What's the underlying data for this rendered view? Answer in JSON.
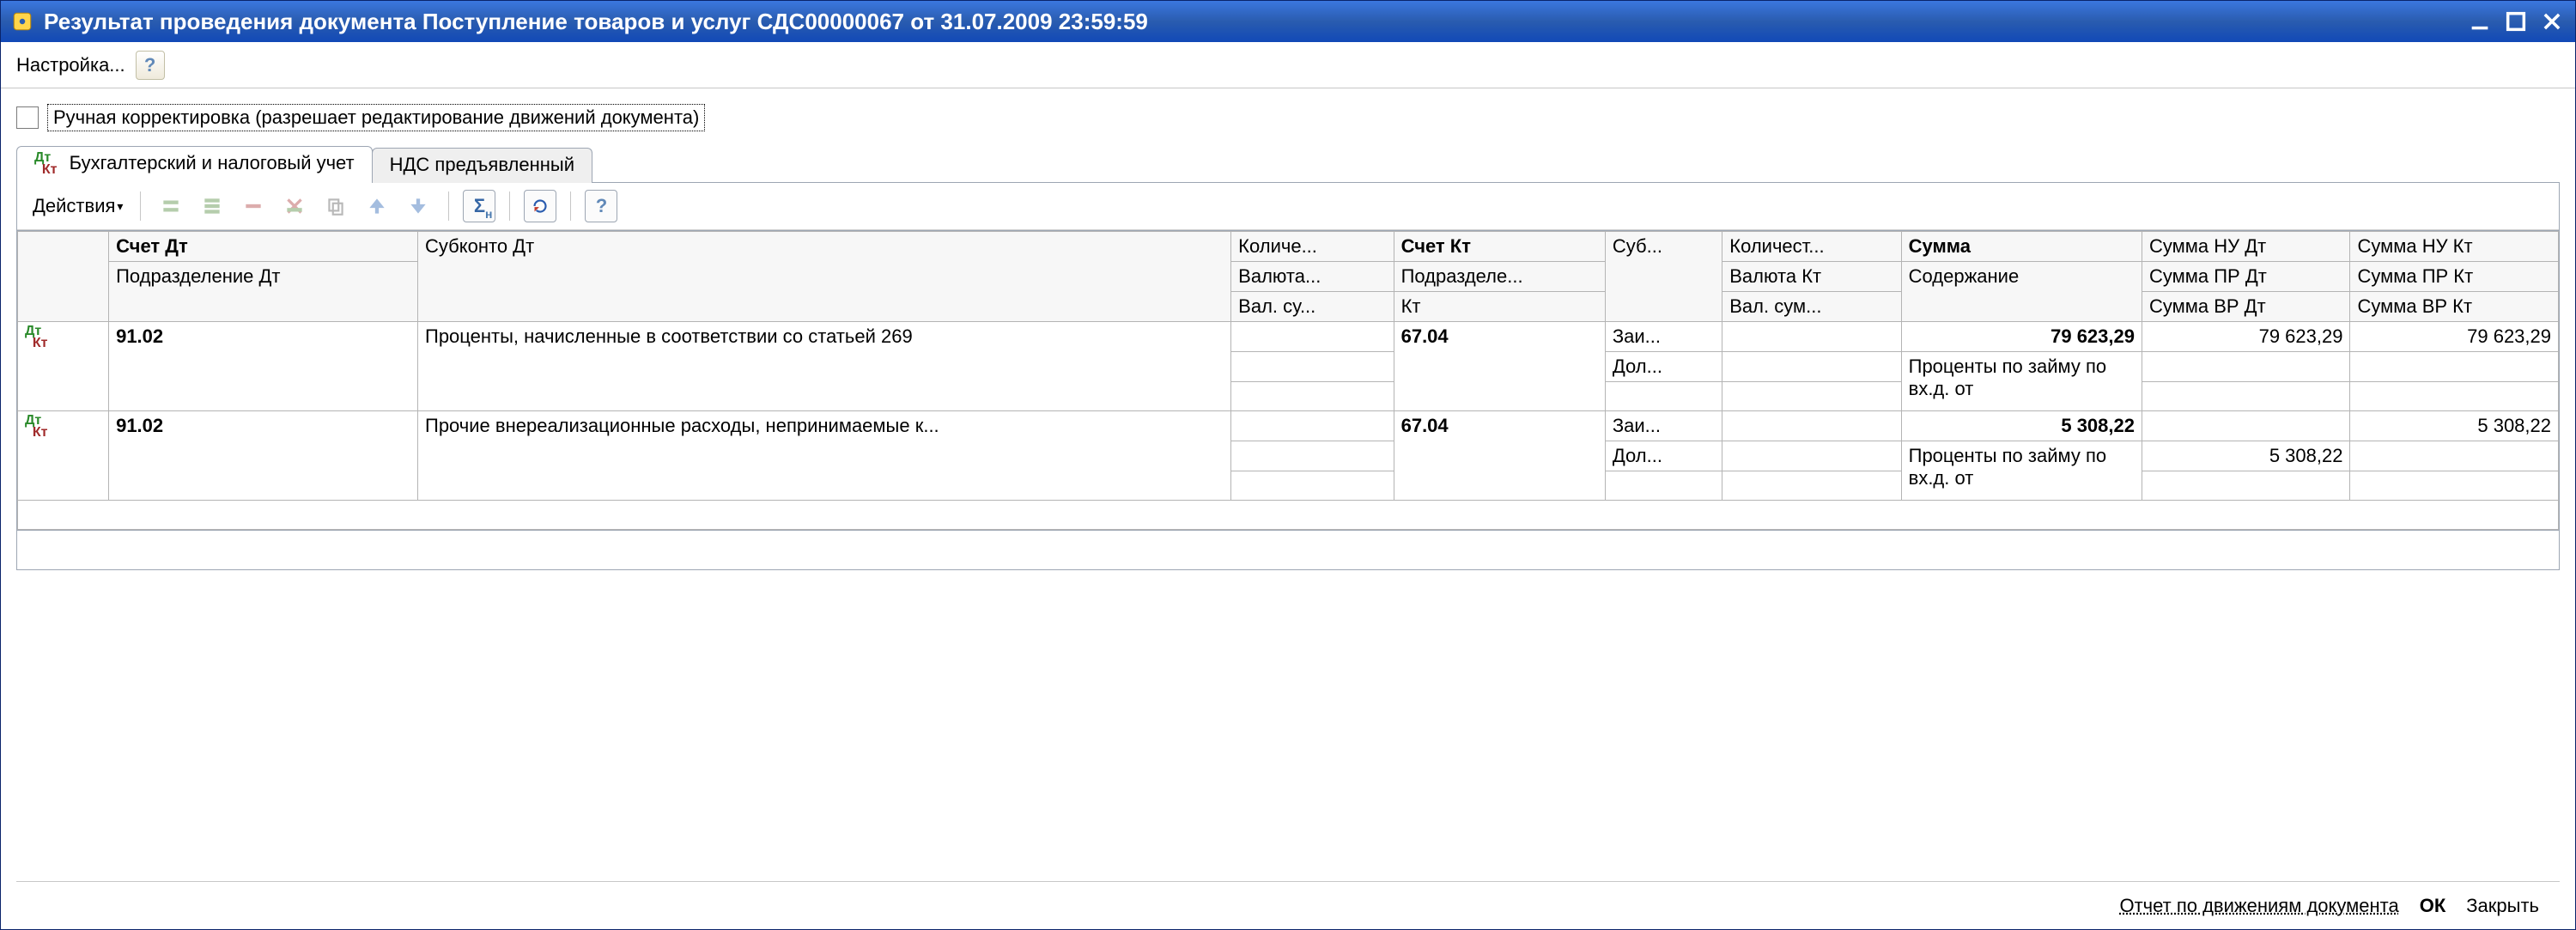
{
  "window": {
    "title": "Результат проведения документа Поступление товаров и услуг СДС00000067 от 31.07.2009 23:59:59",
    "minimize_tooltip": "Свернуть",
    "maximize_tooltip": "Развернуть",
    "close_tooltip": "Закрыть"
  },
  "actionbar": {
    "settings": "Настройка...",
    "help": "?"
  },
  "manual_edit": {
    "checked": false,
    "label": "Ручная корректировка (разрешает редактирование движений документа)"
  },
  "tabs": {
    "accounting": "Бухгалтерский и налоговый учет",
    "vat": "НДС предъявленный"
  },
  "toolbar": {
    "actions": "Действия",
    "help": "?",
    "sigma": "Σ"
  },
  "columns": {
    "r1": {
      "account_dt": "Счет Дт",
      "subkonto_dt": "Субконто Дт",
      "qty_dt": "Количе...",
      "account_kt": "Счет Кт",
      "subkonto_kt": "Суб...",
      "qty_kt": "Количест...",
      "sum": "Сумма",
      "sum_nu_dt": "Сумма НУ Дт",
      "sum_nu_kt": "Сумма НУ Кт"
    },
    "r2": {
      "division_dt": "Подразделение Дт",
      "currency_dt": "Валюта...",
      "division_kt": "Подразделе...",
      "currency_kt": "Валюта Кт",
      "content": "Содержание",
      "sum_pr_dt": "Сумма ПР Дт",
      "sum_pr_kt": "Сумма ПР Кт"
    },
    "r3": {
      "val_sum_dt": "Вал. су...",
      "kt": "Кт",
      "val_sum_kt": "Вал. сум...",
      "sum_vr_dt": "Сумма ВР Дт",
      "sum_vr_kt": "Сумма ВР Кт"
    }
  },
  "rows": [
    {
      "account_dt": "91.02",
      "subkonto_dt": "Проценты, начисленные в соответствии со статьей 269",
      "account_kt": "67.04",
      "subkonto_kt_1": "Заи...",
      "subkonto_kt_2": "Дол...",
      "sum": "79 623,29",
      "content": "Проценты по займу по вх.д. от",
      "sum_nu_dt": "79 623,29",
      "sum_nu_kt": "79 623,29",
      "sum_pr_dt": "",
      "sum_pr_kt": "",
      "sum_vr_dt": "",
      "sum_vr_kt": ""
    },
    {
      "account_dt": "91.02",
      "subkonto_dt": "Прочие внереализационные расходы, непринимаемые к...",
      "account_kt": "67.04",
      "subkonto_kt_1": "Заи...",
      "subkonto_kt_2": "Дол...",
      "sum": "5 308,22",
      "content": "Проценты по займу по вх.д. от",
      "sum_nu_dt": "",
      "sum_nu_kt": "5 308,22",
      "sum_pr_dt": "5 308,22",
      "sum_pr_kt": "",
      "sum_vr_dt": "",
      "sum_vr_kt": ""
    }
  ],
  "footer": {
    "report": "Отчет по движениям документа",
    "ok": "ОК",
    "close": "Закрыть"
  }
}
